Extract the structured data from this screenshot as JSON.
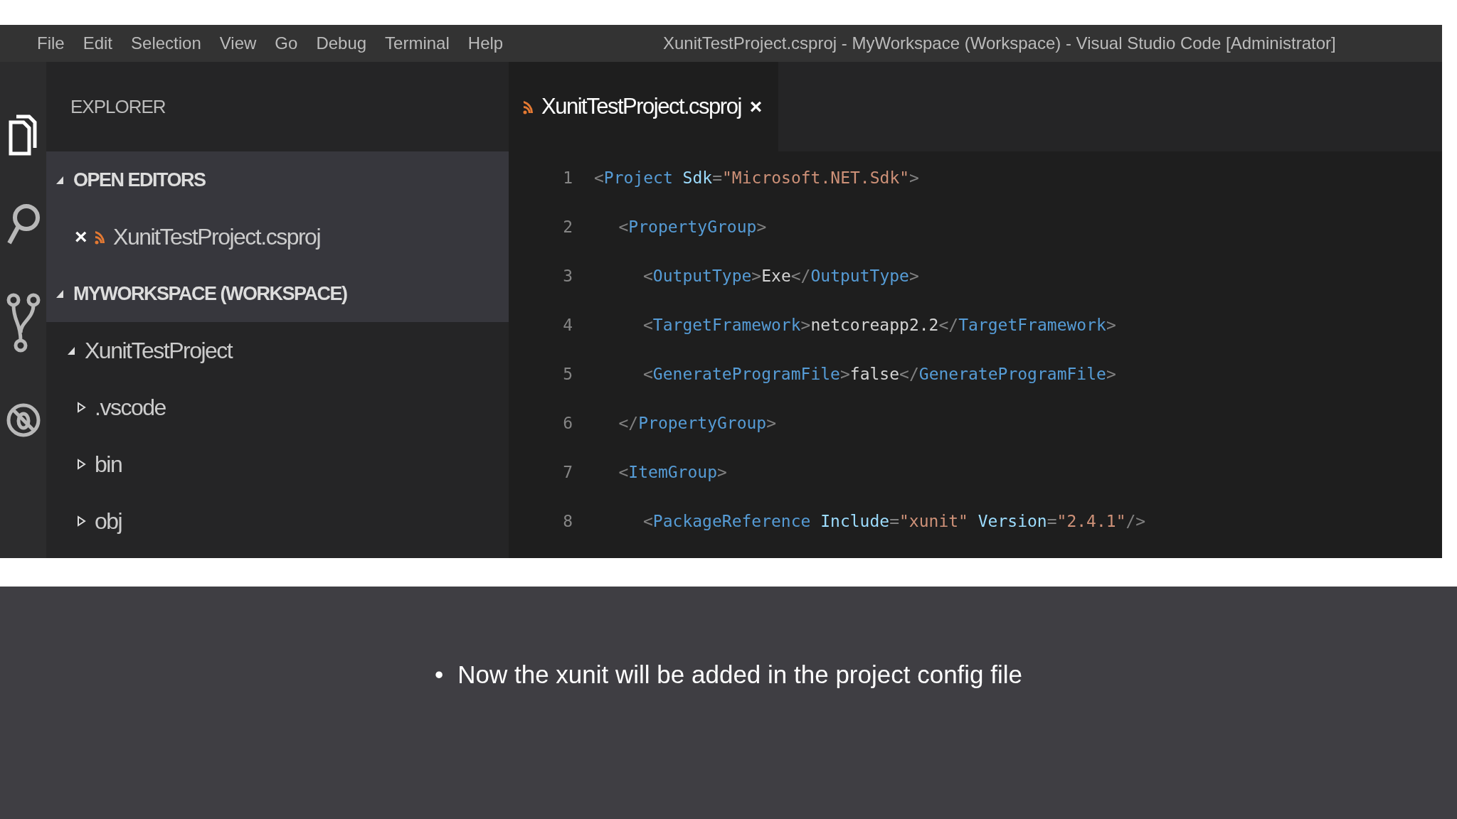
{
  "window": {
    "menu": [
      "File",
      "Edit",
      "Selection",
      "View",
      "Go",
      "Debug",
      "Terminal",
      "Help"
    ],
    "title": "XunitTestProject.csproj - MyWorkspace (Workspace) - Visual Studio Code [Administrator]"
  },
  "activity_bar": [
    {
      "kind": "files",
      "selected": true
    },
    {
      "kind": "search",
      "selected": false
    },
    {
      "kind": "source-control",
      "selected": false
    },
    {
      "kind": "debug",
      "selected": false
    }
  ],
  "sidebar": {
    "title": "EXPLORER",
    "sections": [
      {
        "label": "OPEN EDITORS",
        "expanded": true,
        "items": [
          {
            "label": "XunitTestProject.csproj",
            "close": "×"
          }
        ]
      },
      {
        "label": "MYWORKSPACE (WORKSPACE)",
        "expanded": true,
        "children": [
          {
            "label": "XunitTestProject",
            "expanded": true,
            "children": [
              {
                "label": ".vscode",
                "expanded": false
              },
              {
                "label": "bin",
                "expanded": false
              },
              {
                "label": "obj",
                "expanded": false
              }
            ]
          }
        ]
      }
    ]
  },
  "tabs": [
    {
      "label": "XunitTestProject.csproj",
      "close": "×",
      "selected": true
    }
  ],
  "code": [
    {
      "number": "1",
      "tokens": [
        {
          "kind": "punct",
          "text": "<"
        },
        {
          "kind": "tag",
          "text": "Project"
        },
        {
          "kind": "attr",
          "text": "Sdk"
        },
        {
          "kind": "punct",
          "text": "="
        },
        {
          "kind": "string",
          "text": "\"Microsoft.NET.Sdk\""
        },
        {
          "kind": "punct",
          "text": ">"
        }
      ],
      "children": [
        {
          "number": "2",
          "tokens": [
            {
              "kind": "punct",
              "text": "<"
            },
            {
              "kind": "tag",
              "text": "PropertyGroup"
            },
            {
              "kind": "punct",
              "text": ">"
            }
          ],
          "children": [
            {
              "number": "3",
              "tokens": [
                {
                  "kind": "punct",
                  "text": "<"
                },
                {
                  "kind": "tag",
                  "text": "OutputType"
                },
                {
                  "kind": "punct",
                  "text": ">"
                },
                {
                  "kind": "text",
                  "text": "Exe"
                },
                {
                  "kind": "punct",
                  "text": "</"
                },
                {
                  "kind": "tag",
                  "text": "OutputType"
                },
                {
                  "kind": "punct",
                  "text": ">"
                }
              ]
            },
            {
              "number": "4",
              "tokens": [
                {
                  "kind": "punct",
                  "text": "<"
                },
                {
                  "kind": "tag",
                  "text": "TargetFramework"
                },
                {
                  "kind": "punct",
                  "text": ">"
                },
                {
                  "kind": "text",
                  "text": "netcoreapp2.2"
                },
                {
                  "kind": "punct",
                  "text": "</"
                },
                {
                  "kind": "tag",
                  "text": "TargetFramework"
                },
                {
                  "kind": "punct",
                  "text": ">"
                }
              ]
            },
            {
              "number": "5",
              "tokens": [
                {
                  "kind": "punct",
                  "text": "<"
                },
                {
                  "kind": "tag",
                  "text": "GenerateProgramFile"
                },
                {
                  "kind": "punct",
                  "text": ">"
                },
                {
                  "kind": "text",
                  "text": "false"
                },
                {
                  "kind": "punct",
                  "text": "</"
                },
                {
                  "kind": "tag",
                  "text": "GenerateProgramFile"
                },
                {
                  "kind": "punct",
                  "text": ">"
                }
              ]
            }
          ]
        },
        {
          "number": "6",
          "tokens": [
            {
              "kind": "punct",
              "text": "</"
            },
            {
              "kind": "tag",
              "text": "PropertyGroup"
            },
            {
              "kind": "punct",
              "text": ">"
            }
          ]
        },
        {
          "number": "7",
          "tokens": [
            {
              "kind": "punct",
              "text": "<"
            },
            {
              "kind": "tag",
              "text": "ItemGroup"
            },
            {
              "kind": "punct",
              "text": ">"
            }
          ],
          "children": [
            {
              "number": "8",
              "tokens": [
                {
                  "kind": "punct",
                  "text": "<"
                },
                {
                  "kind": "tag",
                  "text": "PackageReference"
                },
                {
                  "kind": "attr",
                  "text": "Include"
                },
                {
                  "kind": "punct",
                  "text": "="
                },
                {
                  "kind": "string",
                  "text": "\"xunit\""
                },
                {
                  "kind": "attr",
                  "text": "Version"
                },
                {
                  "kind": "punct",
                  "text": "="
                },
                {
                  "kind": "string",
                  "text": "\"2.4.1\""
                },
                {
                  "kind": "punct",
                  "text": "/>"
                }
              ]
            }
          ]
        }
      ]
    }
  ],
  "slide": {
    "bullets": [
      {
        "marker": "•",
        "text": "Now the xunit will be added in the project config file"
      }
    ]
  }
}
